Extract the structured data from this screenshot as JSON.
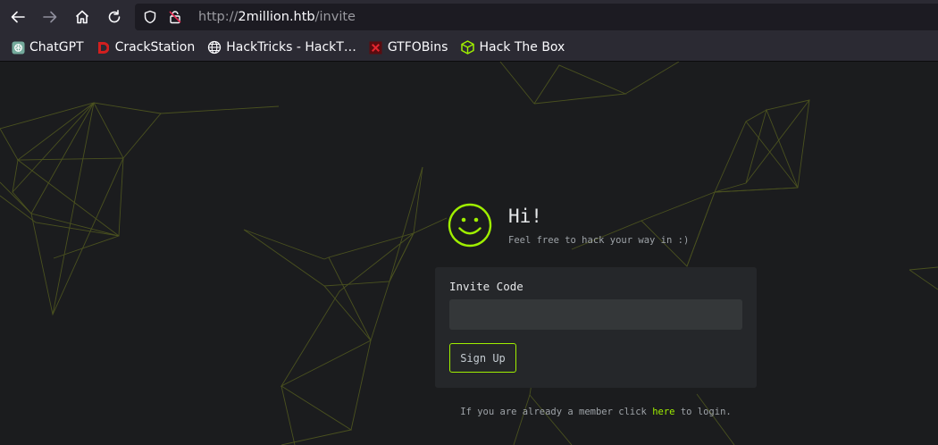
{
  "browser": {
    "url": {
      "protocol": "http://",
      "host": "2million.htb",
      "path": "/invite"
    },
    "bookmarks": [
      {
        "label": "ChatGPT",
        "icon": "chatgpt-icon"
      },
      {
        "label": "CrackStation",
        "icon": "crackstation-icon"
      },
      {
        "label": "HackTricks - HackT…",
        "icon": "globe-icon"
      },
      {
        "label": "GTFOBins",
        "icon": "gtfobins-icon"
      },
      {
        "label": "Hack The Box",
        "icon": "hackthebox-icon"
      }
    ]
  },
  "page": {
    "title": "Hi!",
    "subtitle": "Feel free to hack your way in :)",
    "form": {
      "label": "Invite Code",
      "input_value": "",
      "submit_label": "Sign Up"
    },
    "footer": {
      "before": "If you are already a member click ",
      "link": "here",
      "after": " to login."
    }
  },
  "colors": {
    "accent": "#9fef00",
    "background": "#1b1c1e",
    "card": "#25272a",
    "input": "#343739"
  }
}
